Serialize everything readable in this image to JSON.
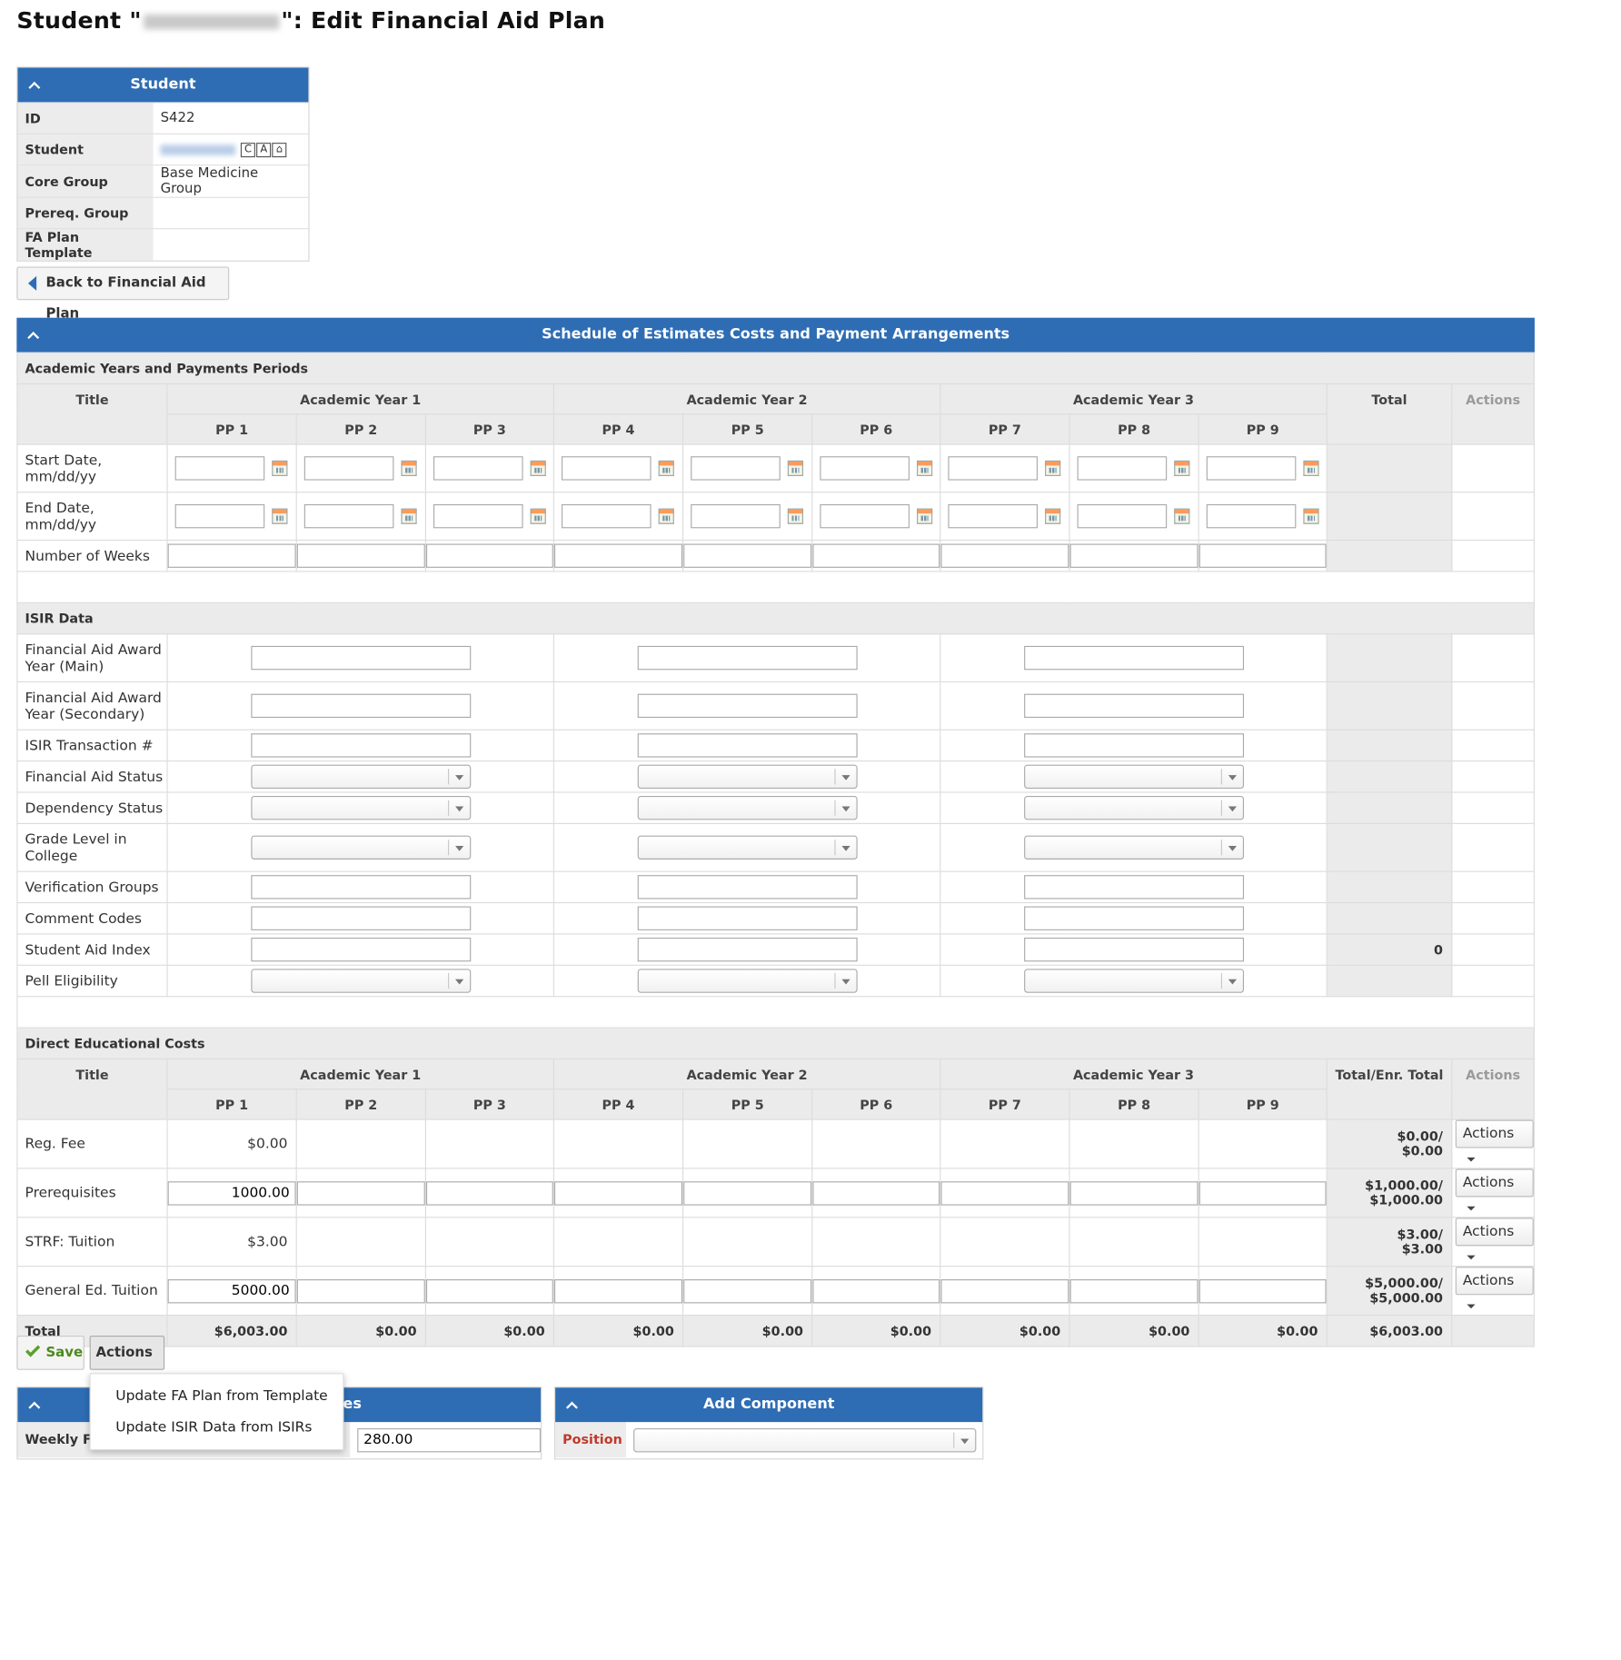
{
  "page": {
    "title_prefix": "Student \"",
    "title_suffix": "\": Edit Financial Aid Plan"
  },
  "student_panel": {
    "title": "Student",
    "rows": [
      {
        "label": "ID",
        "value": "S422"
      },
      {
        "label": "Student",
        "value": ""
      },
      {
        "label": "Core Group",
        "value": "Base Medicine Group"
      },
      {
        "label": "Prereq. Group",
        "value": ""
      },
      {
        "label": "FA Plan Template",
        "value": ""
      }
    ],
    "icons": [
      "C",
      "A",
      "⌂"
    ]
  },
  "back_button": "Back to Financial Aid Plan",
  "schedule": {
    "title": "Schedule of Estimates Costs and Payment Arrangements",
    "section_periods": "Academic Years and Payments Periods",
    "col_title": "Title",
    "years": [
      "Academic Year 1",
      "Academic Year 2",
      "Academic Year 3"
    ],
    "periods": [
      "PP 1",
      "PP 2",
      "PP 3",
      "PP 4",
      "PP 5",
      "PP 6",
      "PP 7",
      "PP 8",
      "PP 9"
    ],
    "col_total": "Total",
    "col_actions": "Actions",
    "row_start": "Start Date, mm/dd/yy",
    "row_end": "End Date, mm/dd/yy",
    "row_weeks": "Number of Weeks",
    "section_isir": "ISIR Data",
    "isir_rows": [
      {
        "label": "Financial Aid Award Year (Main)",
        "type": "text"
      },
      {
        "label": "Financial Aid Award Year (Secondary)",
        "type": "text"
      },
      {
        "label": "ISIR Transaction #",
        "type": "text"
      },
      {
        "label": "Financial Aid Status",
        "type": "select"
      },
      {
        "label": "Dependency Status",
        "type": "select"
      },
      {
        "label": "Grade Level in College",
        "type": "select"
      },
      {
        "label": "Verification Groups",
        "type": "text"
      },
      {
        "label": "Comment Codes",
        "type": "text"
      },
      {
        "label": "Student Aid Index",
        "type": "text",
        "total": "0"
      },
      {
        "label": "Pell Eligibility",
        "type": "select"
      }
    ],
    "section_costs": "Direct Educational Costs",
    "col_total_enr": "Total/Enr. Total",
    "cost_rows": [
      {
        "label": "Reg. Fee",
        "pp1_static": "$0.00",
        "total": "$0.00/",
        "enr_total": "$0.00",
        "action": "Actions"
      },
      {
        "label": "Prerequisites",
        "pp1_input": "1000.00",
        "total": "$1,000.00/",
        "enr_total": "$1,000.00",
        "action": "Actions"
      },
      {
        "label": "STRF: Tuition",
        "pp1_static": "$3.00",
        "total": "$3.00/",
        "enr_total": "$3.00",
        "action": "Actions"
      },
      {
        "label": "General Ed. Tuition",
        "pp1_input": "5000.00",
        "total": "$5,000.00/",
        "enr_total": "$5,000.00",
        "action": "Actions"
      }
    ],
    "total_row": {
      "label": "Total",
      "values": [
        "$6,003.00",
        "$0.00",
        "$0.00",
        "$0.00",
        "$0.00",
        "$0.00",
        "$0.00",
        "$0.00",
        "$0.00"
      ],
      "grand": "$6,003.00"
    }
  },
  "buttons": {
    "save": "Save",
    "actions": "Actions"
  },
  "actions_menu": [
    "Update FA Plan from Template",
    "Update ISIR Data from ISIRs"
  ],
  "bottom_left": {
    "title_fragment": "es",
    "row_label": "Weekly Fe",
    "value": "280.00"
  },
  "bottom_right": {
    "title": "Add Component",
    "row_label": "Position"
  }
}
